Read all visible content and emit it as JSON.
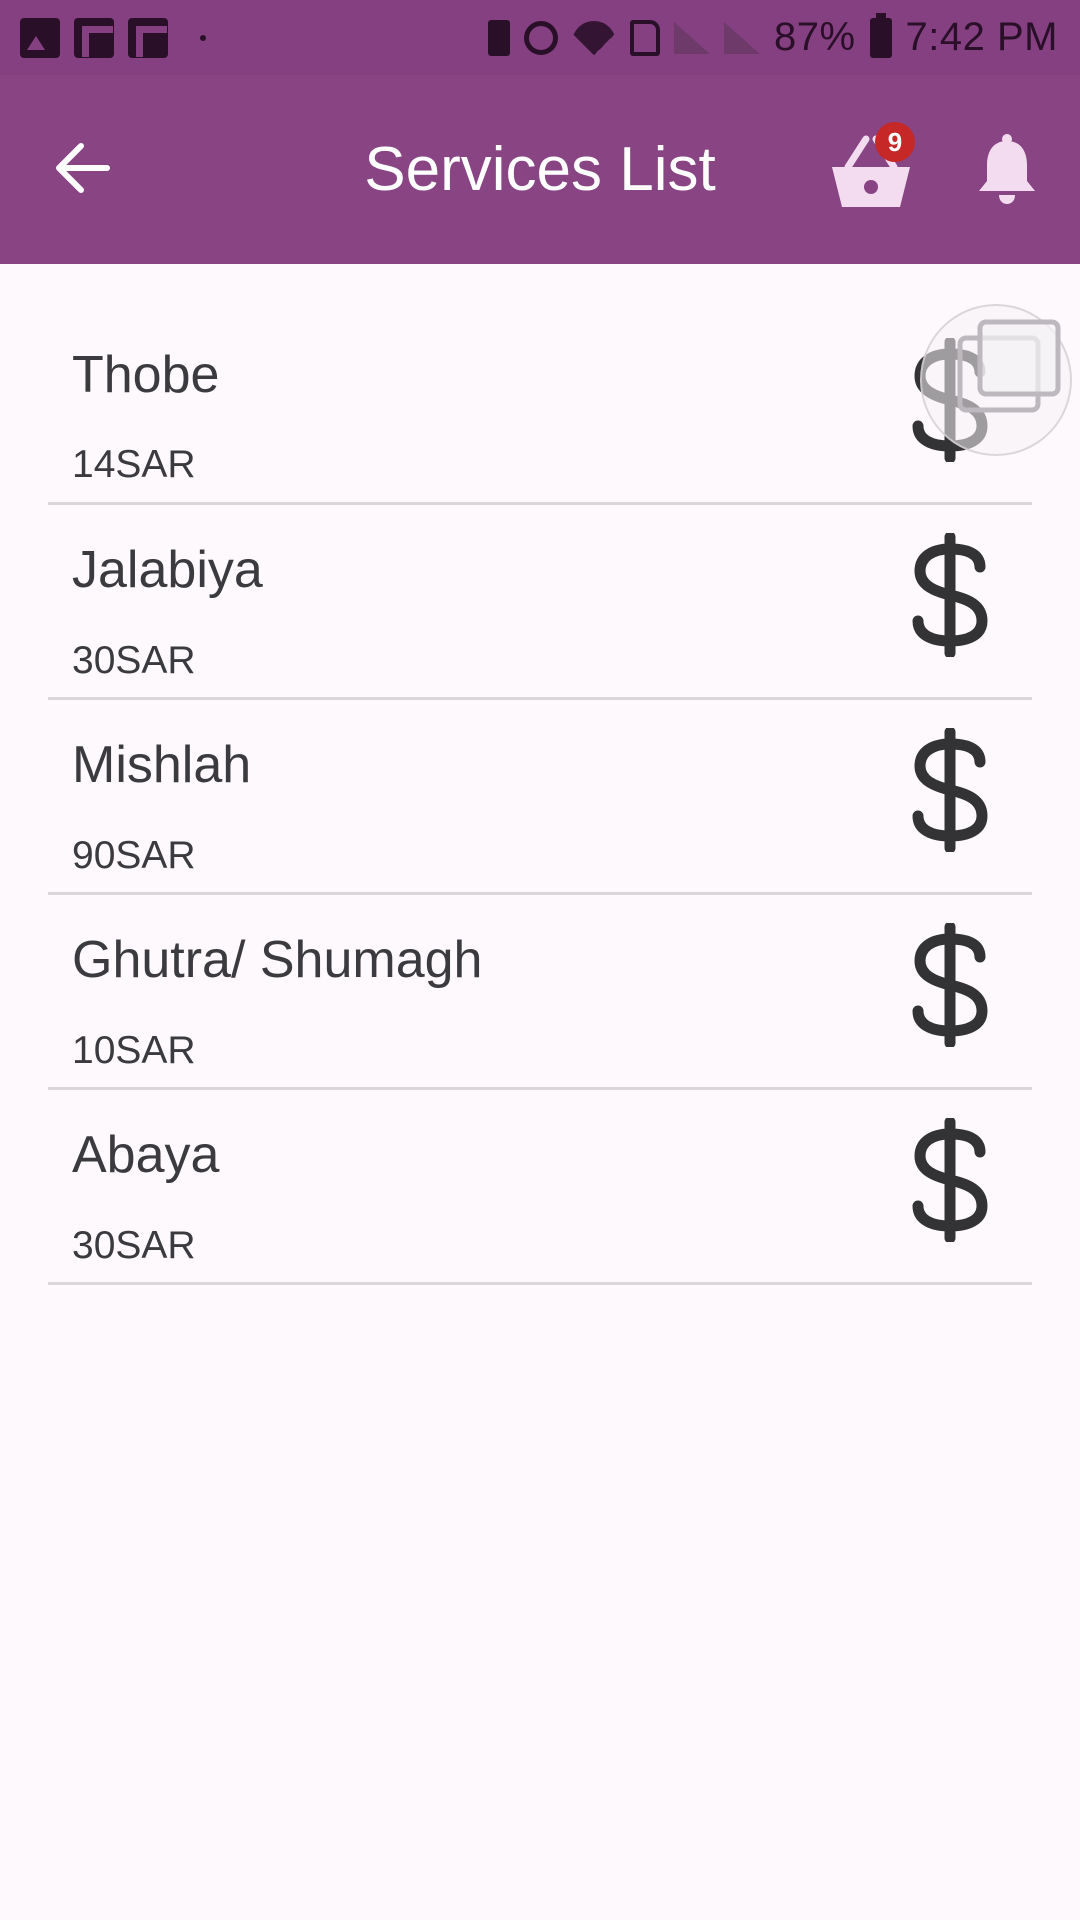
{
  "status_bar": {
    "battery_percent": "87%",
    "time": "7:42 PM"
  },
  "header": {
    "title": "Services List",
    "cart_count": "9"
  },
  "services": [
    {
      "name": "Thobe",
      "price": "14SAR"
    },
    {
      "name": "Jalabiya",
      "price": "30SAR"
    },
    {
      "name": "Mishlah",
      "price": "90SAR"
    },
    {
      "name": "Ghutra/ Shumagh",
      "price": "10SAR"
    },
    {
      "name": "Abaya",
      "price": "30SAR"
    }
  ],
  "colors": {
    "status_bar": "#854081",
    "app_bar": "#884483",
    "badge": "#c62828",
    "background": "#fdf9fc"
  }
}
